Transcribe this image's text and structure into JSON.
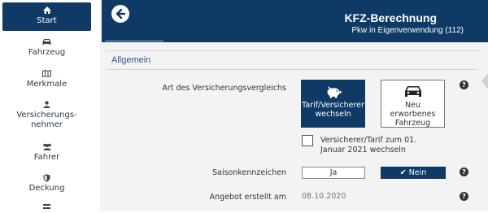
{
  "sidebar": {
    "items": [
      {
        "label": "Start",
        "icon": "home-icon",
        "active": true
      },
      {
        "label": "Fahrzeug",
        "icon": "car-icon"
      },
      {
        "label": "Merkmale",
        "icon": "map-icon"
      },
      {
        "label": "Versicherungs-",
        "label2": "nehmer",
        "icon": "user-icon"
      },
      {
        "label": "Fahrer",
        "icon": "users-icon"
      },
      {
        "label": "Deckung",
        "icon": "shield-icon"
      }
    ]
  },
  "header": {
    "title": "KFZ-Berechnung",
    "subtitle": "Pkw in Eigenverwendung (112)"
  },
  "section": {
    "title": "Allgemein",
    "comparison_label": "Art des Versicherungsvergleichs",
    "option_switch": {
      "line1": "Tarif/Versicherer",
      "line2": "wechseln"
    },
    "option_new": {
      "line1": "Neu erworbenes",
      "line2": "Fahrzeug"
    },
    "checkbox_label": "Versicherer/Tarif zum 01. Januar 2021 wechseln",
    "season_label": "Saisonkennzeichen",
    "season_yes": "Ja",
    "season_no": "✔ Nein",
    "offer_label": "Angebot erstellt am",
    "offer_date": "08.10.2020"
  },
  "colors": {
    "primary": "#0f3a66",
    "section_title": "#2a5a8a"
  }
}
